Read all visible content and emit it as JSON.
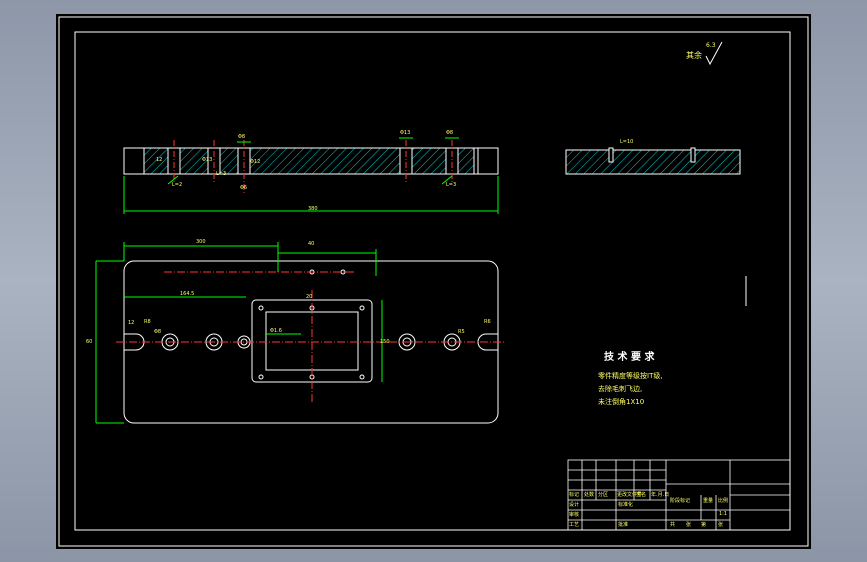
{
  "roughness": {
    "value": "6.3",
    "prefix": "其余"
  },
  "front_view": {
    "dims": [
      "Φ8",
      "Φ13",
      "Φ8",
      "12",
      "Φ13",
      "Φ12",
      "Φ6",
      "L=2",
      "L=3",
      "L=3",
      "380"
    ]
  },
  "side_view": {
    "dims": [
      "L=10"
    ]
  },
  "plan_view": {
    "dims": [
      "300",
      "40",
      "164.5",
      "12",
      "R8",
      "Φ8",
      "60",
      "Φ1.6",
      "20",
      "150",
      "R5",
      "R6"
    ]
  },
  "tech_req": {
    "title": "技 术 要 求",
    "lines": [
      "零件精度等级按IT级,",
      "去除毛刺飞边,",
      "未注倒角1X10"
    ]
  },
  "title_block": {
    "labels": [
      "标记",
      "处数",
      "分区",
      "更改文件号",
      "签名",
      "年.月.日",
      "设计",
      "标准化",
      "审核",
      "工艺",
      "批准",
      "阶段标记",
      "重量",
      "比例",
      "1:1",
      "共",
      "张",
      "第",
      "张"
    ]
  },
  "colors": {
    "outline": "#ffffff",
    "hatch": "#00ffff",
    "dimension": "#00ff00",
    "center": "#ff3333",
    "text": "#ffff66"
  }
}
